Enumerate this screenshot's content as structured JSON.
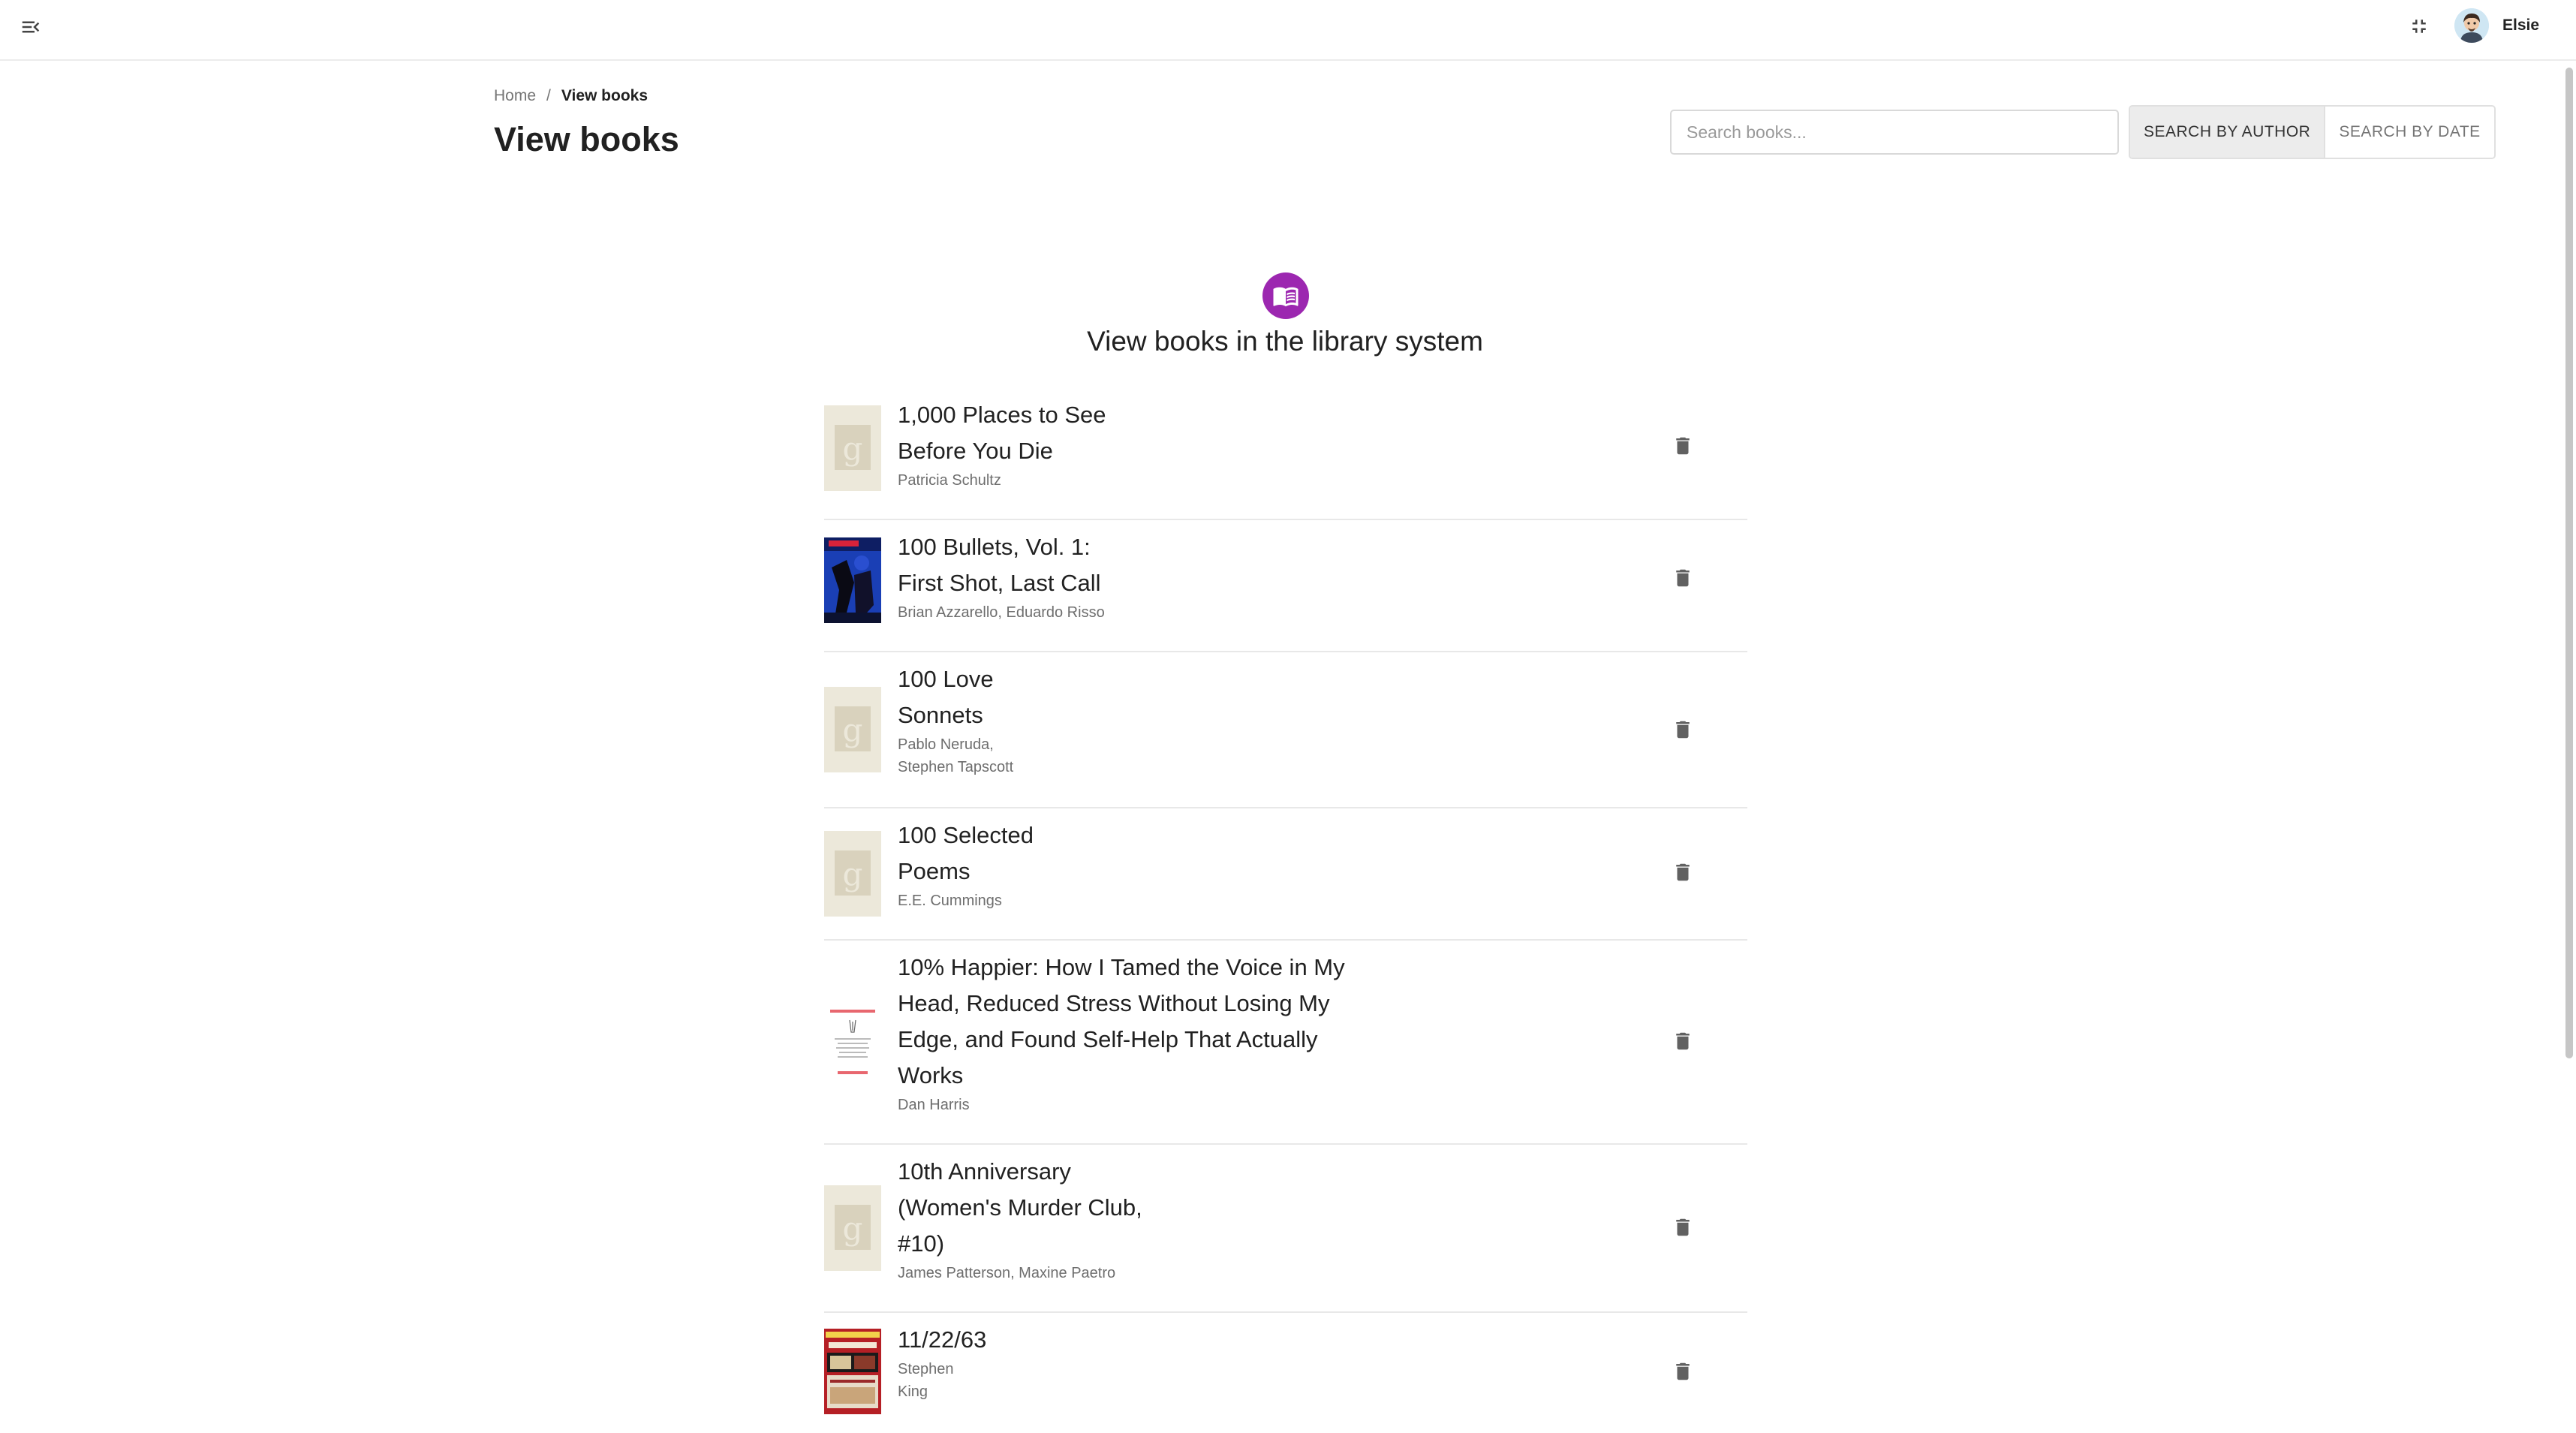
{
  "header": {
    "menu_icon": "menu-open-icon",
    "fullscreen_icon": "fullscreen-exit-icon",
    "user_name": "Elsie"
  },
  "breadcrumb": {
    "home": "Home",
    "separator": "/",
    "current": "View books"
  },
  "page": {
    "title": "View books"
  },
  "search": {
    "placeholder": "Search books...",
    "value": ""
  },
  "search_modes": [
    {
      "label": "SEARCH BY AUTHOR",
      "active": true
    },
    {
      "label": "SEARCH BY DATE",
      "active": false
    }
  ],
  "hero": {
    "icon": "book-open-icon",
    "title": "View books in the library system",
    "accent": "#9c27b0"
  },
  "books": [
    {
      "title_lines": [
        "1,000 Places to See",
        "Before You Die"
      ],
      "author_lines": [
        "Patricia Schultz"
      ],
      "cover": "placeholder"
    },
    {
      "title_lines": [
        "100 Bullets, Vol. 1:",
        "First Shot, Last Call"
      ],
      "author_lines": [
        "Brian Azzarello, Eduardo Risso"
      ],
      "cover": "blue-comic"
    },
    {
      "title_lines": [
        "100 Love",
        "Sonnets"
      ],
      "author_lines": [
        "Pablo Neruda,",
        "Stephen Tapscott"
      ],
      "cover": "placeholder"
    },
    {
      "title_lines": [
        "100 Selected",
        "Poems"
      ],
      "author_lines": [
        "E.E. Cummings"
      ],
      "cover": "placeholder"
    },
    {
      "title_lines": [
        "10% Happier: How I Tamed the Voice in My",
        "Head, Reduced Stress Without Losing My",
        "Edge, and Found Self-Help That Actually",
        "Works"
      ],
      "author_lines": [
        "Dan Harris"
      ],
      "cover": "white-text"
    },
    {
      "title_lines": [
        "10th Anniversary",
        "(Women's Murder Club,",
        "#10)"
      ],
      "author_lines": [
        "James Patterson, Maxine Paetro"
      ],
      "cover": "placeholder"
    },
    {
      "title_lines": [
        "11/22/63"
      ],
      "author_lines": [
        "Stephen",
        "King"
      ],
      "cover": "red-king"
    }
  ],
  "colors": {
    "accent": "#9c27b0",
    "divider": "#e8e8e8",
    "delete_icon": "#616161"
  }
}
